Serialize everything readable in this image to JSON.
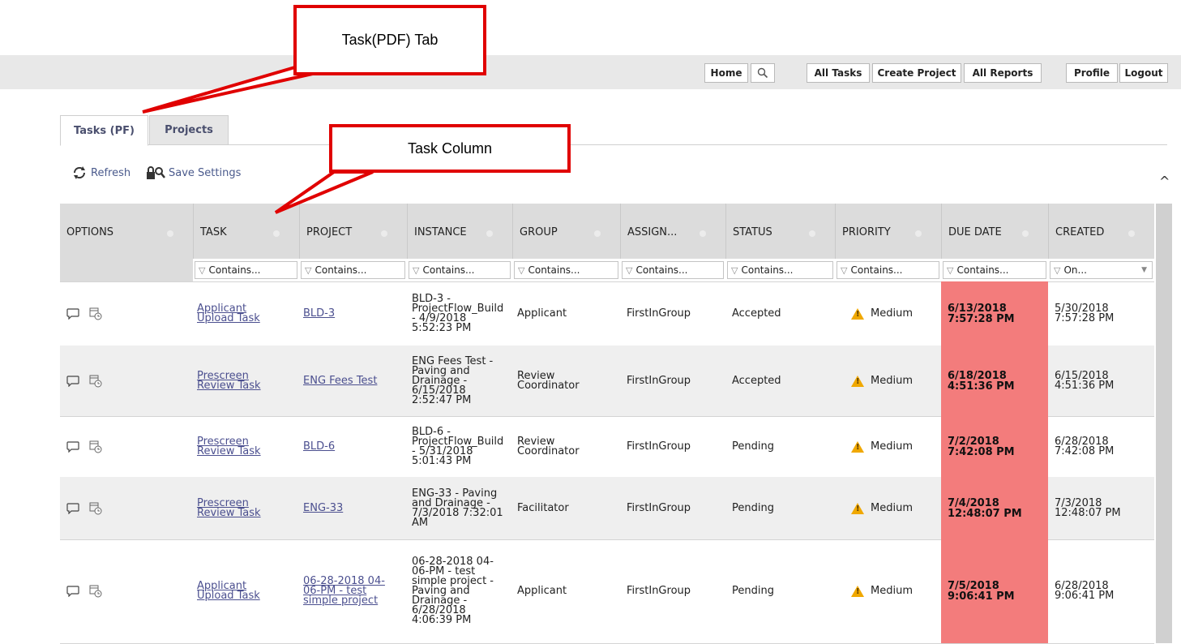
{
  "callouts": {
    "tab_callout": "Task(PDF) Tab",
    "column_callout": "Task Column"
  },
  "nav": {
    "home": "Home",
    "all_tasks": "All Tasks",
    "create_project": "Create Project",
    "all_reports": "All Reports",
    "profile": "Profile",
    "logout": "Logout"
  },
  "tabs": [
    {
      "label": "Tasks (PF)",
      "active": true
    },
    {
      "label": "Projects",
      "active": false
    }
  ],
  "toolbar": {
    "refresh": "Refresh",
    "save_settings": "Save Settings"
  },
  "grid": {
    "columns": [
      "OPTIONS",
      "TASK",
      "PROJECT",
      "INSTANCE",
      "GROUP",
      "ASSIGN...",
      "STATUS",
      "PRIORITY",
      "DUE DATE",
      "CREATED"
    ],
    "filters": [
      "",
      "Contains...",
      "Contains...",
      "Contains...",
      "Contains...",
      "Contains...",
      "Contains...",
      "Contains...",
      "Contains...",
      "On..."
    ],
    "rows": [
      {
        "task": [
          "Applicant",
          "Upload Task"
        ],
        "project": [
          "BLD-3"
        ],
        "instance": [
          "BLD-3 -",
          "ProjectFlow_Build",
          "- 4/9/2018",
          "5:52:23 PM"
        ],
        "group": [
          "Applicant"
        ],
        "assign": "FirstInGroup",
        "status": "Accepted",
        "priority": "Medium",
        "due": [
          "6/13/2018",
          "7:57:28 PM"
        ],
        "created": [
          "5/30/2018",
          "7:57:28 PM"
        ]
      },
      {
        "task": [
          "Prescreen",
          "Review Task"
        ],
        "project": [
          "ENG Fees Test"
        ],
        "instance": [
          "ENG Fees Test -",
          "Paving and",
          "Drainage -",
          "6/15/2018",
          "2:52:47 PM"
        ],
        "group": [
          "Review",
          "Coordinator"
        ],
        "assign": "FirstInGroup",
        "status": "Accepted",
        "priority": "Medium",
        "due": [
          "6/18/2018",
          "4:51:36 PM"
        ],
        "created": [
          "6/15/2018",
          "4:51:36 PM"
        ]
      },
      {
        "task": [
          "Prescreen",
          "Review Task"
        ],
        "project": [
          "BLD-6"
        ],
        "instance": [
          "BLD-6 -",
          "ProjectFlow_Build",
          "- 5/31/2018",
          "5:01:43 PM"
        ],
        "group": [
          "Review",
          "Coordinator"
        ],
        "assign": "FirstInGroup",
        "status": "Pending",
        "priority": "Medium",
        "due": [
          "7/2/2018",
          "7:42:08 PM"
        ],
        "created": [
          "6/28/2018",
          "7:42:08 PM"
        ]
      },
      {
        "task": [
          "Prescreen",
          "Review Task"
        ],
        "project": [
          "ENG-33"
        ],
        "instance": [
          "ENG-33 - Paving",
          "and Drainage -",
          "7/3/2018 7:32:01",
          "AM"
        ],
        "group": [
          "Facilitator"
        ],
        "assign": "FirstInGroup",
        "status": "Pending",
        "priority": "Medium",
        "due": [
          "7/4/2018",
          "12:48:07 PM"
        ],
        "created": [
          "7/3/2018",
          "12:48:07 PM"
        ]
      },
      {
        "task": [
          "Applicant",
          "Upload Task"
        ],
        "project": [
          "06-28-2018 04-",
          "06-PM - test",
          "simple project"
        ],
        "instance": [
          "06-28-2018 04-",
          "06-PM - test",
          "simple project -",
          "Paving and",
          "Drainage -",
          "6/28/2018",
          "4:06:39 PM"
        ],
        "group": [
          "Applicant"
        ],
        "assign": "FirstInGroup",
        "status": "Pending",
        "priority": "Medium",
        "due": [
          "7/5/2018",
          "9:06:41 PM"
        ],
        "created": [
          "6/28/2018",
          "9:06:41 PM"
        ]
      }
    ]
  },
  "colors": {
    "overdue": "#f37c7c",
    "callout_border": "#e00000",
    "link": "#4b4f8f",
    "warning": "#f0a800"
  },
  "icons": [
    "search-icon",
    "refresh-icon",
    "save-settings-icon",
    "comment-icon",
    "schedule-icon",
    "filter-icon",
    "warning-icon",
    "scroll-up-icon",
    "dropdown-arrow-icon"
  ]
}
